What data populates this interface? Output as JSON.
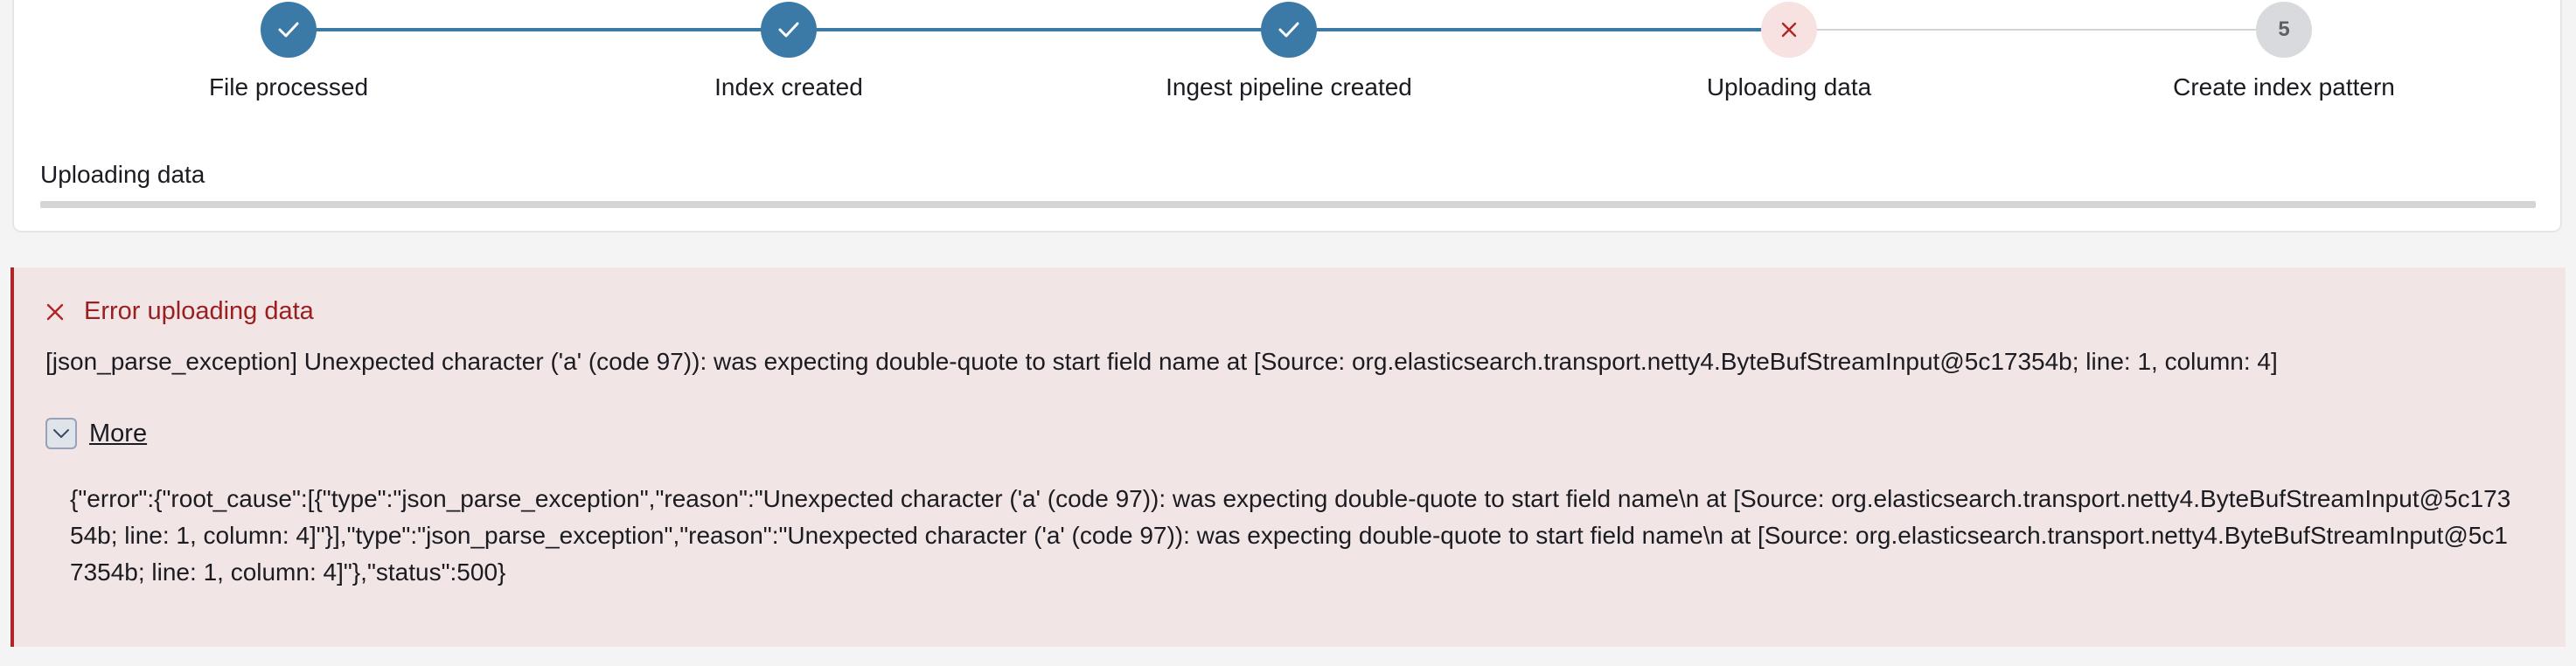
{
  "steps": [
    {
      "label": "File processed",
      "state": "done"
    },
    {
      "label": "Index created",
      "state": "done"
    },
    {
      "label": "Ingest pipeline created",
      "state": "done"
    },
    {
      "label": "Uploading data",
      "state": "error"
    },
    {
      "label": "Create index pattern",
      "state": "todo",
      "number": "5"
    }
  ],
  "upload": {
    "label": "Uploading data",
    "progress_percent": 0
  },
  "error": {
    "title": "Error uploading data",
    "message": "[json_parse_exception] Unexpected character ('a' (code 97)): was expecting double-quote to start field name at [Source: org.elasticsearch.transport.netty4.ByteBufStreamInput@5c17354b; line: 1, column: 4]",
    "more_label": "More",
    "details": "{\"error\":{\"root_cause\":[{\"type\":\"json_parse_exception\",\"reason\":\"Unexpected character ('a' (code 97)): was expecting double-quote to start field name\\n at [Source: org.elasticsearch.transport.netty4.ByteBufStreamInput@5c17354b; line: 1, column: 4]\"}],\"type\":\"json_parse_exception\",\"reason\":\"Unexpected character ('a' (code 97)): was expecting double-quote to start field name\\n at [Source: org.elasticsearch.transport.netty4.ByteBufStreamInput@5c17354b; line: 1, column: 4]\"},\"status\":500}"
  },
  "colors": {
    "done": "#3b7aa6",
    "error": "#b02628",
    "todo": "#d9dadd",
    "callout_bg": "#f2e5e5"
  },
  "icons": {
    "done": "check-icon",
    "error": "cross-icon",
    "more_toggle": "chevron-down-icon"
  }
}
